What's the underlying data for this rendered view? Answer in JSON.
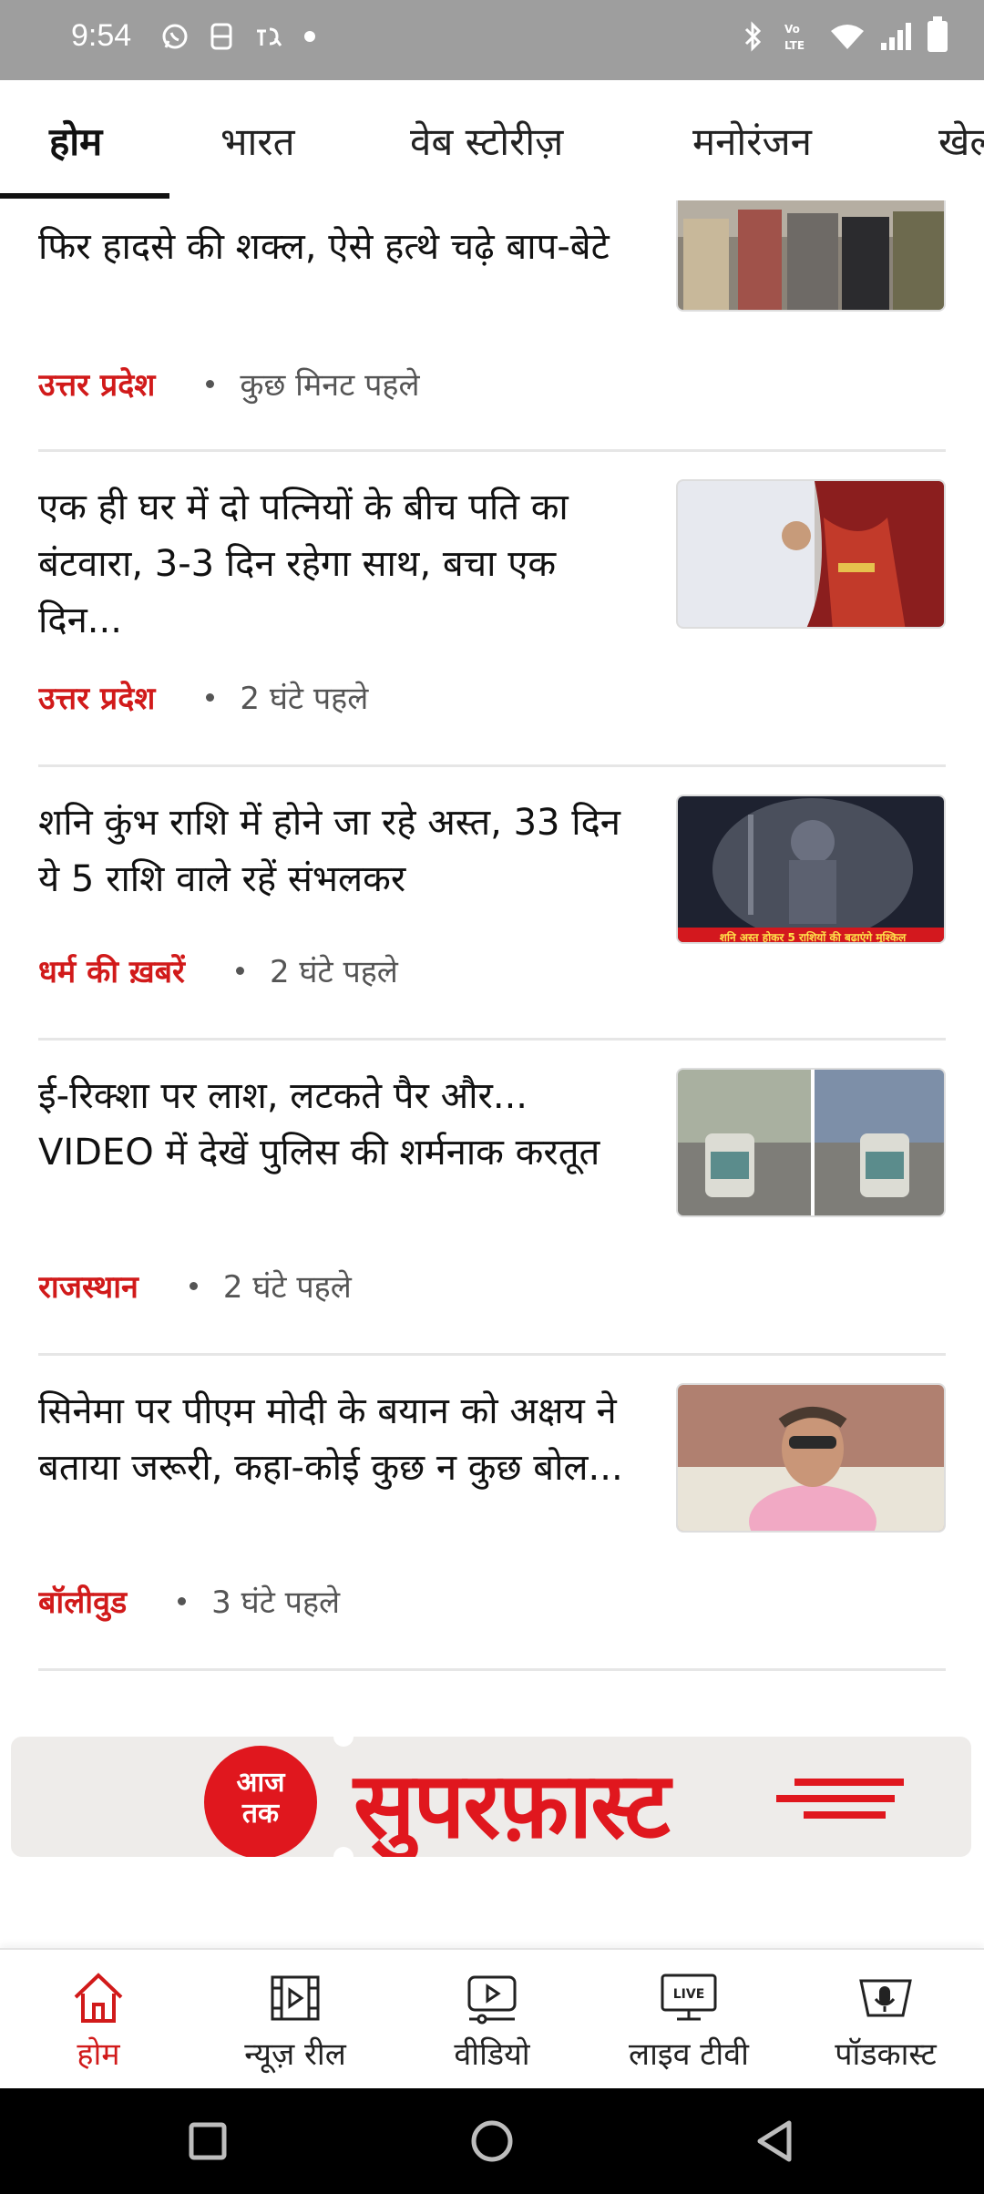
{
  "status_bar": {
    "time": "9:54",
    "left_icons": [
      "whatsapp-icon",
      "notification-icon",
      "app-icon",
      "dot-icon"
    ],
    "right_icons": [
      "bluetooth-icon",
      "volte-icon",
      "wifi-icon",
      "signal-icon",
      "battery-icon"
    ],
    "volte_text": "VoLTE"
  },
  "tabs": [
    {
      "label": "होम",
      "active": true
    },
    {
      "label": "भारत",
      "active": false
    },
    {
      "label": "वेब स्टोरीज़",
      "active": false
    },
    {
      "label": "मनोरंजन",
      "active": false
    },
    {
      "label": "खेल",
      "active": false
    }
  ],
  "articles": [
    {
      "headline": "फिर हादसे की शक्ल, ऐसे हत्थे चढ़े बाप-बेटे",
      "category": "उत्तर प्रदेश",
      "time": "कुछ मिनट पहले",
      "thumbnail": "group-of-men-photo"
    },
    {
      "headline": "एक ही घर में दो पत्नियों के बीच पति का बंटवारा, 3-3 दिन रहेगा साथ, बचा एक दिन...",
      "category": "उत्तर प्रदेश",
      "time": "2 घंटे पहले",
      "thumbnail": "couple-photo"
    },
    {
      "headline": "शनि कुंभ राशि में होने जा रहे अस्त, 33 दिन ये 5 राशि वाले रहें संभलकर",
      "category": "धर्म की ख़बरें",
      "time": "2 घंटे पहले",
      "thumbnail": "shani-idol-photo",
      "thumbnail_caption": "शनि अस्त होकर 5 राशियों की बढ़ाएंगे मुश्किल"
    },
    {
      "headline": "ई-रिक्शा पर लाश, लटकते पैर और... VIDEO में देखें पुलिस की शर्मनाक करतूत",
      "category": "राजस्थान",
      "time": "2 घंटे पहले",
      "thumbnail": "e-rickshaw-photo"
    },
    {
      "headline": "सिनेमा पर पीएम मोदी के बयान को अक्षय ने बताया जरूरी, कहा-कोई कुछ न कुछ बोल...",
      "category": "बॉलीवुड",
      "time": "3 घंटे पहले",
      "thumbnail": "actor-photo"
    }
  ],
  "banner": {
    "logo_line1": "आज",
    "logo_line2": "तक",
    "title": "सुपरफ़ास्ट"
  },
  "bottom_nav": [
    {
      "label": "होम",
      "icon": "home-icon",
      "active": true
    },
    {
      "label": "न्यूज़ रील",
      "icon": "film-reel-icon",
      "active": false
    },
    {
      "label": "वीडियो",
      "icon": "video-play-icon",
      "active": false
    },
    {
      "label": "लाइव टीवी",
      "icon": "live-tv-icon",
      "active": false,
      "icon_text": "LIVE"
    },
    {
      "label": "पॉडकास्ट",
      "icon": "podcast-icon",
      "active": false
    }
  ],
  "colors": {
    "accent": "#d11a1a",
    "brand_red": "#e0171e",
    "status_bar": "#9e9e9e"
  }
}
